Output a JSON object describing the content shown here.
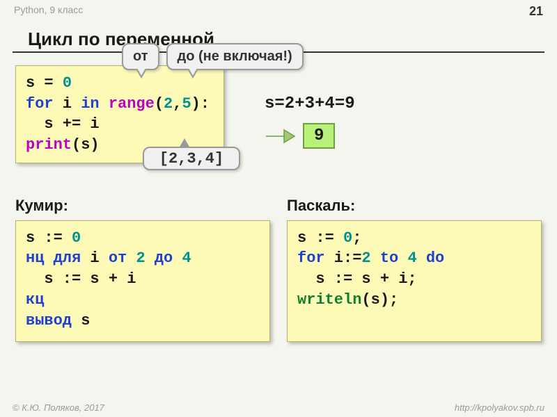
{
  "header": {
    "course": "Python, 9 класс",
    "page": "21"
  },
  "title": "Цикл по переменной",
  "callouts": {
    "from": "от",
    "to": "до (не включая!)",
    "list": "[2,3,4]"
  },
  "python": {
    "l1a": "s = ",
    "l1b": "0",
    "l2a": "for",
    "l2b": " i ",
    "l2c": "in",
    "l2d": " ",
    "l2e": "range",
    "l2f": "(",
    "l2g": "2",
    "l2h": ",",
    "l2i": "5",
    "l2j": "):",
    "l3": "  s += i",
    "l4a": "print",
    "l4b": "(s)"
  },
  "equation": "s=2+3+4=9",
  "result": "9",
  "kumir": {
    "title": "Кумир:",
    "l1a": "s := ",
    "l1b": "0",
    "l2a": "нц для",
    "l2b": " i ",
    "l2c": "от",
    "l2d": " ",
    "l2e": "2",
    "l2f": " ",
    "l2g": "до",
    "l2h": " ",
    "l2i": "4",
    "l3": "  s := s + i",
    "l4": "кц",
    "l5a": "вывод",
    "l5b": " s"
  },
  "pascal": {
    "title": "Паскаль:",
    "l1a": "s := ",
    "l1b": "0",
    "l1c": ";",
    "l2a": "for",
    "l2b": " i:=",
    "l2c": "2",
    "l2d": " ",
    "l2e": "to",
    "l2f": " ",
    "l2g": "4",
    "l2h": " ",
    "l2i": "do",
    "l3": "  s := s + i;",
    "l4a": "writeln",
    "l4b": "(s);"
  },
  "footer": {
    "left": "© К.Ю. Поляков, 2017",
    "right": "http://kpolyakov.spb.ru"
  }
}
